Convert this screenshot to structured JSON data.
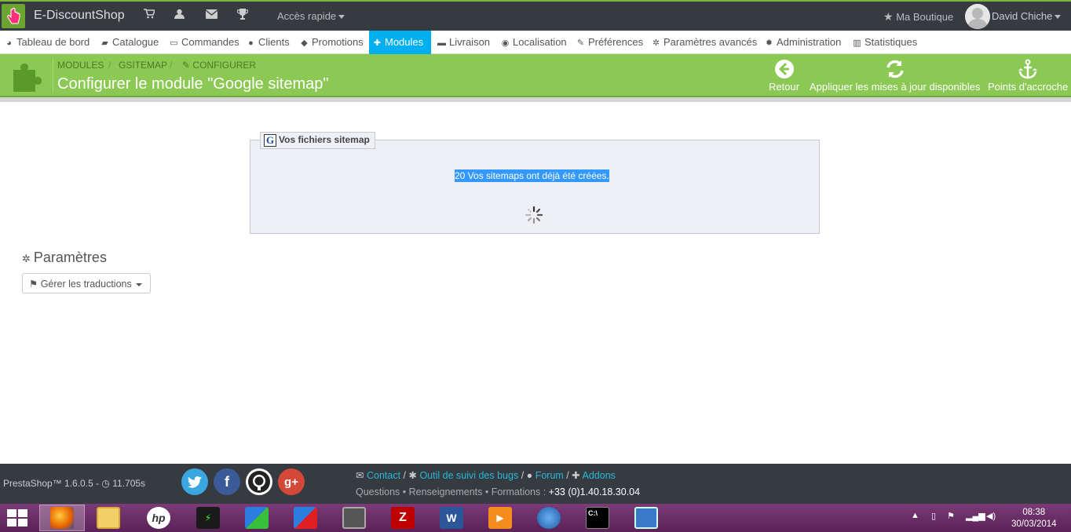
{
  "header": {
    "shop_name": "E-DiscountShop",
    "quick_access": "Accès rapide",
    "my_shop": "Ma Boutique",
    "user_name": "David Chiche"
  },
  "nav": {
    "items": [
      {
        "label": "Tableau de bord",
        "icon": "dashboard-icon"
      },
      {
        "label": "Catalogue",
        "icon": "book-icon"
      },
      {
        "label": "Commandes",
        "icon": "credit-card-icon"
      },
      {
        "label": "Clients",
        "icon": "users-icon"
      },
      {
        "label": "Promotions",
        "icon": "tags-icon"
      },
      {
        "label": "Modules",
        "icon": "puzzle-icon"
      },
      {
        "label": "Livraison",
        "icon": "truck-icon"
      },
      {
        "label": "Localisation",
        "icon": "globe-icon"
      },
      {
        "label": "Préférences",
        "icon": "wrench-icon"
      },
      {
        "label": "Paramètres avancés",
        "icon": "cogs-icon"
      },
      {
        "label": "Administration",
        "icon": "cog-icon"
      },
      {
        "label": "Statistiques",
        "icon": "bar-chart-icon"
      }
    ],
    "active": "Modules"
  },
  "page_header": {
    "breadcrumb": [
      "MODULES",
      "GSITEMAP",
      "CONFIGURER"
    ],
    "breadcrumb_sep": "/",
    "title": "Configurer le module \"Google sitemap\"",
    "toolbar": {
      "back": "Retour",
      "update": "Appliquer les mises à jour disponibles",
      "hooks": "Points d'accroche"
    }
  },
  "sitemap_panel": {
    "legend": "Vos fichiers sitemap",
    "legend_icon_letter": "G",
    "message": "20 Vos sitemaps ont déjà été créées."
  },
  "params": {
    "title": "Paramètres",
    "translations_button": "Gérer les traductions"
  },
  "footer": {
    "version": "PrestaShop™ 1.6.0.5 - ",
    "load_time": "11.705s",
    "links": [
      "Contact",
      "Outil de suivi des bugs",
      "Forum",
      "Addons"
    ],
    "link_sep": " / ",
    "info": "Questions • Renseignements • Formations : ",
    "phone": "+33 (0)1.40.18.30.04",
    "social": [
      "twitter-icon",
      "facebook-icon",
      "github-icon",
      "google-plus-icon"
    ]
  },
  "taskbar": {
    "apps": [
      "firefox",
      "file-explorer",
      "hp",
      "network-monitor",
      "remote-desktop-green",
      "remote-desktop-red",
      "presentation",
      "filezilla",
      "word",
      "media-player",
      "thunderbird",
      "command-prompt",
      "network-connection"
    ],
    "time": "08:38",
    "date": "30/03/2014"
  },
  "colors": {
    "topbar": "#363a41",
    "header_green": "#8bc954",
    "active_tab": "#00aff0",
    "link": "#25b9d7",
    "selection": "#3399ff"
  }
}
